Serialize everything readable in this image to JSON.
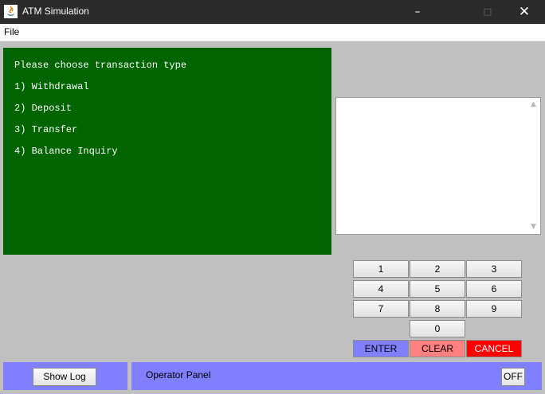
{
  "window": {
    "title": "ATM Simulation",
    "controls": {
      "minimize": "–",
      "maximize": "□",
      "close": "✕"
    }
  },
  "menubar": {
    "file": "File"
  },
  "display": {
    "lines": [
      "Please choose transaction type",
      "1) Withdrawal",
      "2) Deposit",
      "3) Transfer",
      "4) Balance Inquiry"
    ]
  },
  "log_area": {
    "value": "",
    "scroll_up": "▲",
    "scroll_down": "▼"
  },
  "keypad": {
    "digits": [
      "1",
      "2",
      "3",
      "4",
      "5",
      "6",
      "7",
      "8",
      "9",
      "0"
    ],
    "enter": "ENTER",
    "clear": "CLEAR",
    "cancel": "CANCEL"
  },
  "bottom": {
    "show_log": "Show Log",
    "operator_panel": "Operator Panel",
    "off": "OFF"
  },
  "colors": {
    "screen_bg": "#006400",
    "enter": "#8080ff",
    "clear": "#ff8080",
    "cancel": "#ff0000",
    "panel": "#8080ff"
  }
}
